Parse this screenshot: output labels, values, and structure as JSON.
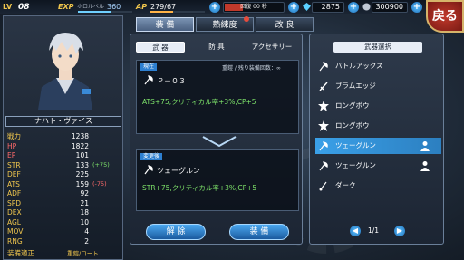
{
  "top_bar": {
    "lv_label": "LV",
    "lv_value": "08",
    "exp_label": "EXP",
    "exp_sub": "ホロルベル",
    "exp_value": "360",
    "exp_progress": 0.6,
    "ap_label": "AP",
    "ap_value": "279/",
    "ap_max": "67",
    "ap_progress": 0.416,
    "recover_label": "回復 00 秒",
    "currency1": "2875",
    "currency2": "300900",
    "back_label": "戻る"
  },
  "character": {
    "name": "ナハト・ヴァイス",
    "stats": [
      {
        "label": "戦力",
        "value": "1238",
        "mod": ""
      },
      {
        "label": "HP",
        "value": "1822",
        "mod": ""
      },
      {
        "label": "EP",
        "value": "101",
        "mod": ""
      },
      {
        "label": "STR",
        "value": "133",
        "mod": "(+75)"
      },
      {
        "label": "DEF",
        "value": "225",
        "mod": ""
      },
      {
        "label": "ATS",
        "value": "159",
        "mod": "(-75)"
      },
      {
        "label": "ADF",
        "value": "92",
        "mod": ""
      },
      {
        "label": "SPD",
        "value": "21",
        "mod": ""
      },
      {
        "label": "DEX",
        "value": "18",
        "mod": ""
      },
      {
        "label": "AGL",
        "value": "10",
        "mod": ""
      },
      {
        "label": "MOV",
        "value": "4",
        "mod": ""
      },
      {
        "label": "RNG",
        "value": "2",
        "mod": ""
      }
    ],
    "aptitude_label": "装備適正",
    "aptitude_value": "重鎧/コート"
  },
  "tabs": [
    {
      "label": "装 備"
    },
    {
      "label": "熟練度"
    },
    {
      "label": "改 良"
    }
  ],
  "sub_tabs": [
    {
      "label": "武 器"
    },
    {
      "label": "防 具"
    },
    {
      "label": "アクセサリー"
    }
  ],
  "current": {
    "tag": "現在",
    "note": "重鎧 / 残り装備回数：∞",
    "weapon": "Ｐ－０３",
    "effect": "ATS+75,クリティカル率+3%,CP+5"
  },
  "after": {
    "tag": "変更後",
    "weapon": "ツェーグルン",
    "effect": "STR+75,クリティカル率+3%,CP+5"
  },
  "buttons": {
    "unequip": "解 除",
    "equip": "装 備"
  },
  "weapon_select": {
    "title": "武器選択",
    "items": [
      {
        "name": "バトルアックス",
        "icon": "axe-icon",
        "equipped": false
      },
      {
        "name": "ブラムエッジ",
        "icon": "sword-icon",
        "equipped": false
      },
      {
        "name": "ロングボウ",
        "icon": "star-icon",
        "equipped": false
      },
      {
        "name": "ロングボウ",
        "icon": "star-icon",
        "equipped": false
      },
      {
        "name": "ツェーグルン",
        "icon": "axe-icon",
        "equipped": true
      },
      {
        "name": "ツェーグルン",
        "icon": "axe-icon",
        "equipped": true
      },
      {
        "name": "ダーク",
        "icon": "dagger-icon",
        "equipped": false
      }
    ],
    "selected_index": 4,
    "page": "1/1"
  }
}
